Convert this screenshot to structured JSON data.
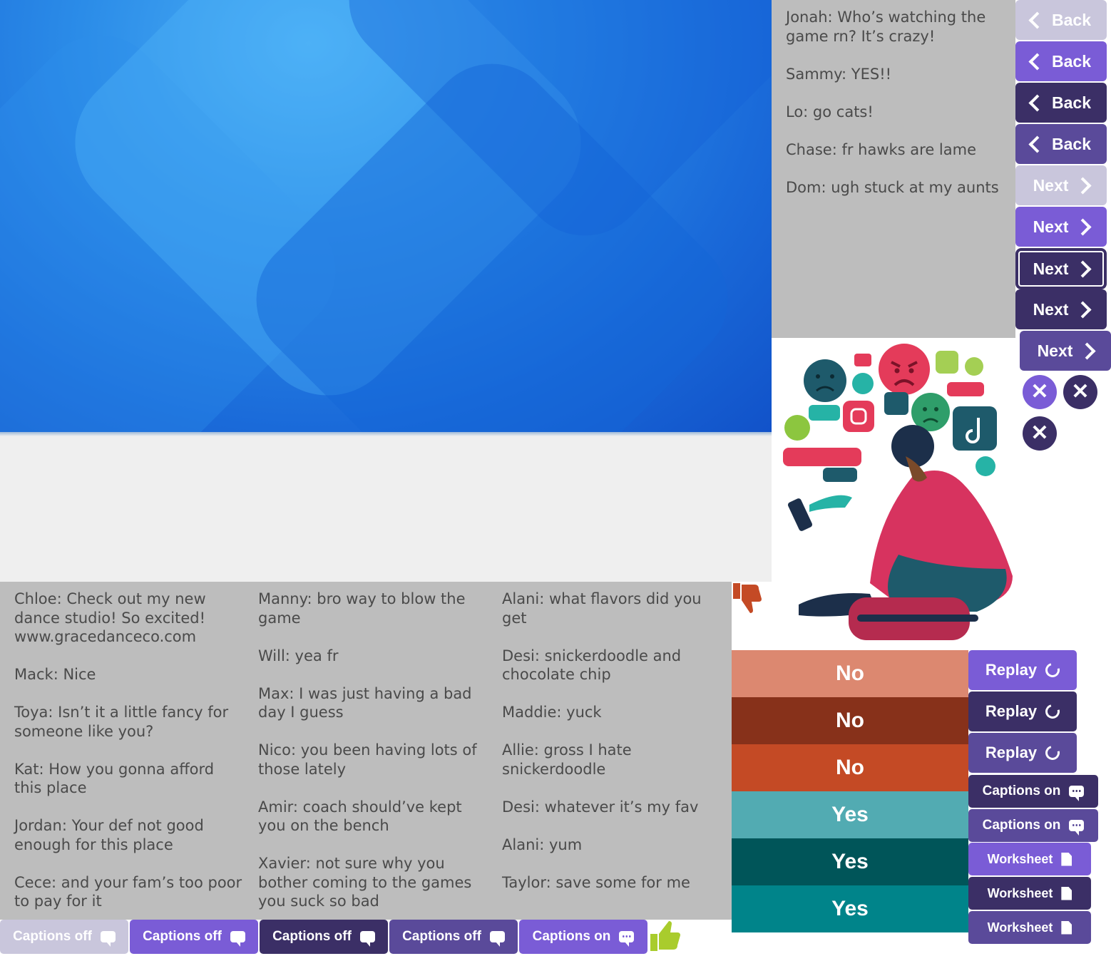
{
  "chat_top": {
    "messages": [
      "Jonah: Who’s watching the game rn? It’s crazy!",
      "Sammy: YES!!",
      "Lo: go cats!",
      "Chase: fr hawks are lame",
      "Dom: ugh stuck at my aunts"
    ]
  },
  "chat_bottom": {
    "col1": [
      "Chloe: Check out my new dance studio! So excited! www.gracedanceco.com",
      "Mack: Nice",
      "Toya: Isn’t it a little fancy for someone like you?",
      "Kat: How you gonna afford this place",
      "Jordan: Your def not good enough for this place",
      "Cece: and your fam’s too poor to pay for it"
    ],
    "col2": [
      "Manny: bro way to blow the game",
      "Will: yea fr",
      "Max: I was just having a bad day I guess",
      "Nico: you been having lots of those lately",
      "Amir: coach should’ve kept you on the bench",
      "Xavier: not sure why you bother coming to the games you suck so bad"
    ],
    "col3": [
      "Alani: what flavors did you get",
      "Desi: snickerdoodle and chocolate chip",
      "Maddie: yuck",
      "Allie: gross I hate snickerdoodle",
      "Desi: whatever it’s my fav",
      "Alani: yum",
      "Taylor: save some for me"
    ]
  },
  "nav": {
    "back_label": "Back",
    "next_label": "Next",
    "close_glyph": "✕"
  },
  "answers": {
    "no_label": "No",
    "yes_label": "Yes"
  },
  "actions": {
    "replay_label": "Replay",
    "captions_on_label": "Captions on",
    "captions_off_label": "Captions off",
    "worksheet_label": "Worksheet"
  },
  "colors": {
    "back_light": "#c9c6dc",
    "purple": "#7a5cd6",
    "dark_navy": "#3b2f66",
    "mid_purple": "#5a4a9a",
    "no_light": "#dc8870",
    "no_dark": "#87311a",
    "no_mid": "#c44a25",
    "yes_light": "#52abb2",
    "yes_dark": "#005559",
    "yes_mid": "#00848a"
  },
  "illustration": {
    "subject": "teen-on-phone-with-social-media-icons"
  }
}
